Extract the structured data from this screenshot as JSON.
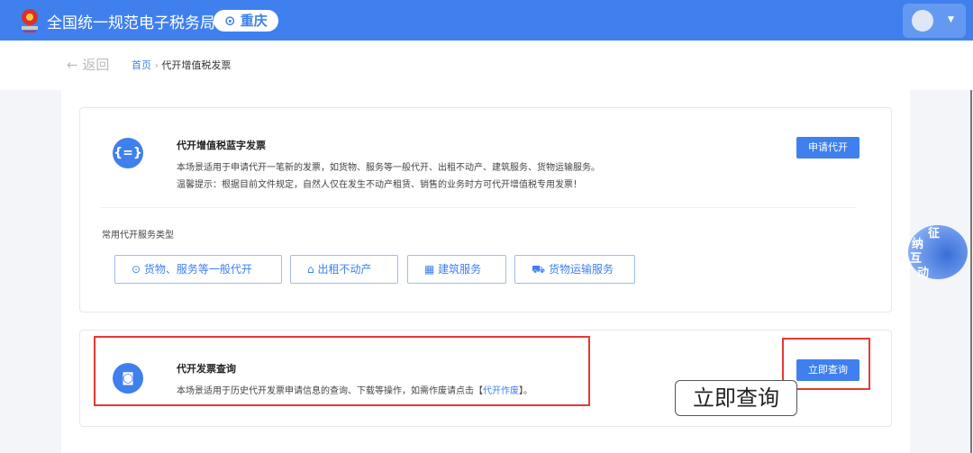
{
  "header": {
    "title": "全国统一规范电子税务局",
    "city": "重庆"
  },
  "nav": {
    "back": "← 返回",
    "home": "首页",
    "sep": "›",
    "current": "代开增值税发票"
  },
  "card1": {
    "title": "代开增值税蓝字发票",
    "desc": "本场景适用于申请代开一笔新的发票，如货物、服务等一般代开、出租不动产、建筑服务、货物运输服务。",
    "tip": "温馨提示：根据目前文件规定，自然人仅在发生不动产租赁、销售的业务时方可代开增值税专用发票！",
    "button": "申请代开",
    "services_label": "常用代开服务类型",
    "services": [
      "货物、服务等一般代开",
      "出租不动产",
      "建筑服务",
      "货物运输服务"
    ]
  },
  "card2": {
    "title": "代开发票查询",
    "desc_pre": "本场景适用于历史代开发票申请信息的查询、下载等操作，如需作废请点击【",
    "link": "代开作废",
    "desc_post": "】。",
    "button": "立即查询"
  },
  "callout": "立即查询",
  "mascot": {
    "c1": "征",
    "c2": "纳",
    "c3": "互",
    "c4": "动"
  }
}
